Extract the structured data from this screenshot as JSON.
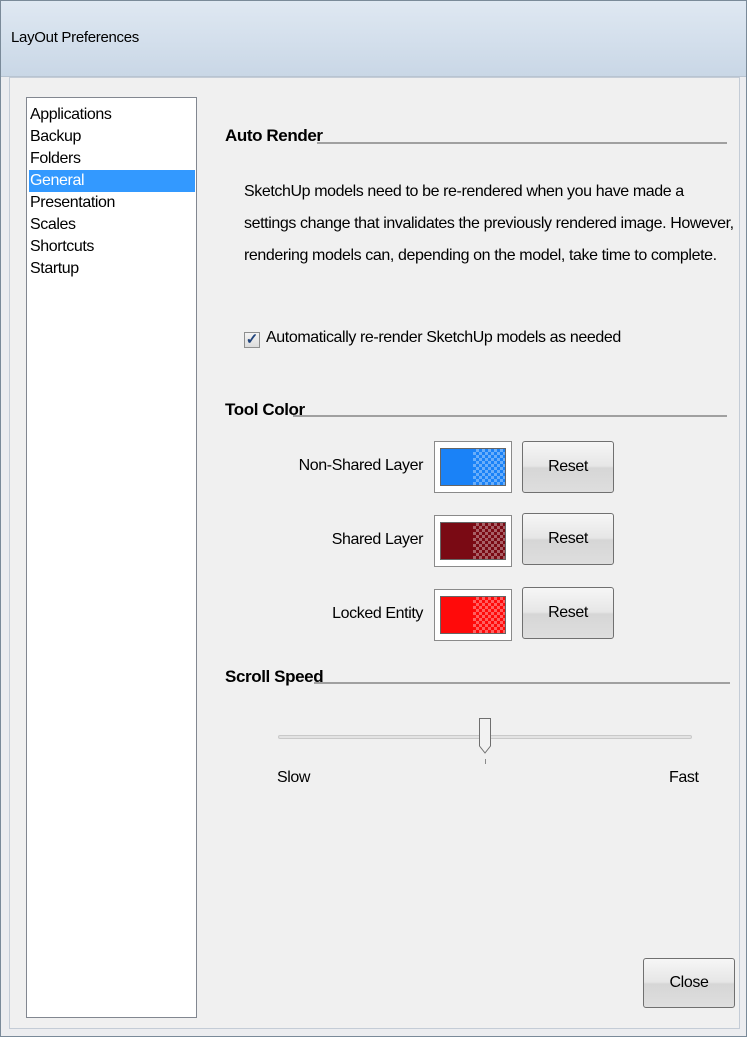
{
  "window": {
    "title": "LayOut Preferences"
  },
  "sidebar": {
    "items": [
      {
        "label": "Applications",
        "selected": false
      },
      {
        "label": "Backup",
        "selected": false
      },
      {
        "label": "Folders",
        "selected": false
      },
      {
        "label": "General",
        "selected": true
      },
      {
        "label": "Presentation",
        "selected": false
      },
      {
        "label": "Scales",
        "selected": false
      },
      {
        "label": "Shortcuts",
        "selected": false
      },
      {
        "label": "Startup",
        "selected": false
      }
    ]
  },
  "auto_render": {
    "heading": "Auto Render",
    "description": "SketchUp models need to be re-rendered when you have made a settings change that invalidates the previously rendered image.  However, rendering models can, depending on the model, take time to complete.",
    "checkbox_label": "Automatically re-render SketchUp models as needed",
    "checked": true
  },
  "tool_color": {
    "heading": "Tool Color",
    "rows": [
      {
        "label": "Non-Shared Layer",
        "color": "#1a82f7",
        "reset_label": "Reset"
      },
      {
        "label": "Shared Layer",
        "color": "#7a0a14",
        "reset_label": "Reset"
      },
      {
        "label": "Locked Entity",
        "color": "#ff0a0a",
        "reset_label": "Reset"
      }
    ]
  },
  "scroll_speed": {
    "heading": "Scroll Speed",
    "min_label": "Slow",
    "max_label": "Fast",
    "value": 0.5
  },
  "footer": {
    "close_label": "Close"
  }
}
